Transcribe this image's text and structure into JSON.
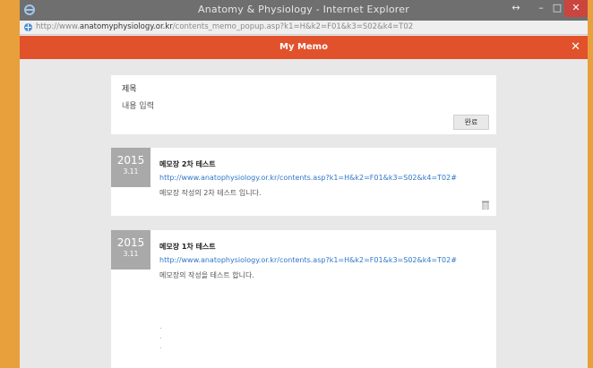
{
  "window": {
    "title": "Anatomy & Physiology - Internet Explorer",
    "url_prefix": "http://www.",
    "url_domain": "anatomyphysiology.or.kr",
    "url_rest": "/contents_memo_popup.asp?k1=H&k2=F01&k3=S02&k4=T02",
    "restore_glyph": "↔",
    "minimize_glyph": "–",
    "maximize_glyph": "□",
    "close_glyph": "✕"
  },
  "memo": {
    "header_title": "My Memo",
    "close_glyph": "✕",
    "editor": {
      "title": "제목",
      "body": "내용 입력",
      "done_label": "완료"
    },
    "entries": [
      {
        "year": "2015",
        "month_day": "3.11",
        "title": "메모장 2차 테스트",
        "link": "http://www.anatophysiology.or.kr/contents.asp?k1=H&k2=F01&k3=S02&k4=T02#",
        "text": "메모장 작성의 2차 테스트 입니다."
      },
      {
        "year": "2015",
        "month_day": "3.11",
        "title": "메모장 1차 테스트",
        "link": "http://www.anatophysiology.or.kr/contents.asp?k1=H&k2=F01&k3=S02&k4=T02#",
        "text": "메모장의 작성을 테스트 합니다.",
        "dots": [
          ".",
          ".",
          "."
        ]
      }
    ]
  },
  "colors": {
    "accent": "#e1512b",
    "titlebar": "#6f6f6f",
    "link": "#2f76c8",
    "date_box": "#a9a9a9",
    "frame_border": "#e8a03c"
  }
}
